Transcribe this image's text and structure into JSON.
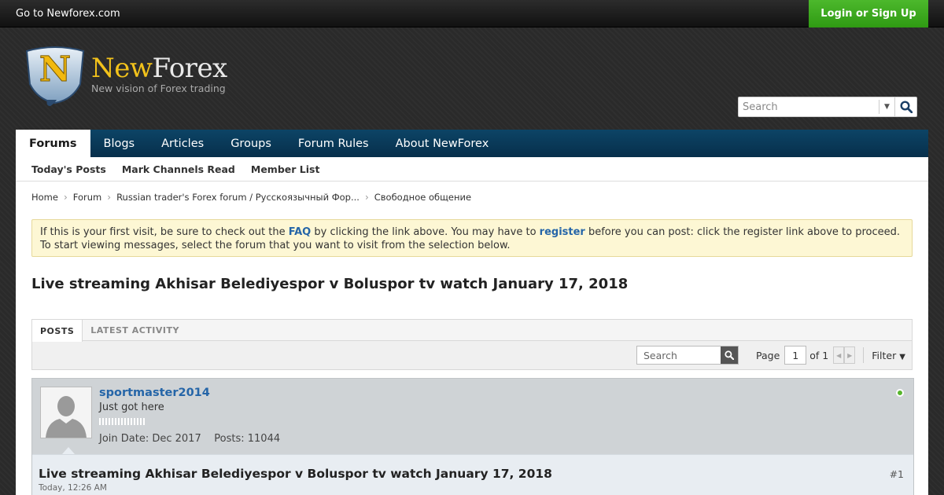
{
  "topbar": {
    "goto_link": "Go to Newforex.com",
    "login_button": "Login or Sign Up"
  },
  "logo": {
    "letter": "N",
    "name_part1": "New",
    "name_part2": "Forex",
    "tagline": "New vision of Forex trading"
  },
  "header_search": {
    "placeholder": "Search",
    "icon": "search-icon",
    "dropdown_icon": "caret-down-icon"
  },
  "nav": {
    "tabs": [
      {
        "label": "Forums",
        "active": true
      },
      {
        "label": "Blogs"
      },
      {
        "label": "Articles"
      },
      {
        "label": "Groups"
      },
      {
        "label": "Forum Rules"
      },
      {
        "label": "About NewForex"
      }
    ]
  },
  "subnav": {
    "items": [
      "Today's Posts",
      "Mark Channels Read",
      "Member List"
    ]
  },
  "breadcrumb": [
    "Home",
    "Forum",
    "Russian trader's Forex forum / Русскоязычный Фор...",
    "Свободное общение"
  ],
  "notice": {
    "text1": "If this is your first visit, be sure to check out the ",
    "faq_link": "FAQ",
    "text2": " by clicking the link above. You may have to ",
    "register_link": "register",
    "text3": " before you can post: click the register link above to proceed.",
    "line2": "To start viewing messages, select the forum that you want to visit from the selection below."
  },
  "thread": {
    "title": "Live streaming Akhisar Belediyespor v Boluspor tv watch January 17, 2018"
  },
  "tabs": {
    "items": [
      {
        "label": "POSTS",
        "active": true
      },
      {
        "label": "LATEST ACTIVITY"
      }
    ]
  },
  "toolbar": {
    "search_placeholder": "Search",
    "page_label": "Page",
    "page_value": "1",
    "of_label": "of 1",
    "filter_label": "Filter"
  },
  "post": {
    "username": "sportmaster2014",
    "user_title": "Just got here",
    "join_date": "Join Date: Dec 2017",
    "posts": "Posts: 11044",
    "online": true,
    "online_color": "#56b52c",
    "title": "Live streaming Akhisar Belediyespor v Boluspor tv watch January 17, 2018",
    "date": "Today, 12:26 AM",
    "number": "#1"
  },
  "colors": {
    "nav_bg": "#0c4466",
    "login_bg": "#3aa81d",
    "link": "#2565a8",
    "notice_bg": "#fdf7d4"
  }
}
